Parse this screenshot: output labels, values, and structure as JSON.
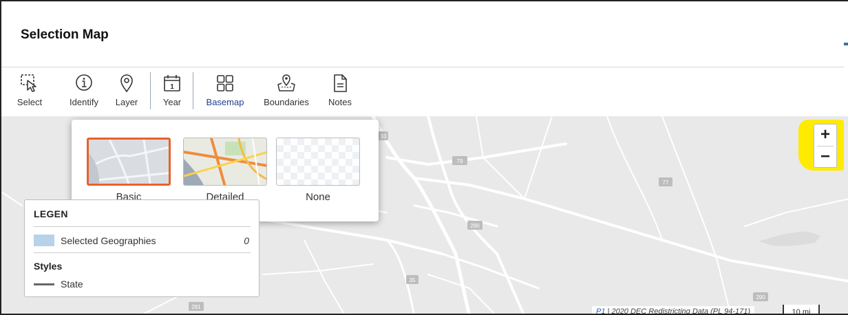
{
  "window": {
    "title": "Selection Map"
  },
  "toolbar": {
    "tools": [
      {
        "id": "select",
        "label": "Select",
        "icon": "select-icon"
      },
      {
        "id": "identify",
        "label": "Identify",
        "icon": "info-icon"
      },
      {
        "id": "layer",
        "label": "Layer",
        "icon": "location-pin-icon"
      },
      {
        "id": "year",
        "label": "Year",
        "icon": "calendar-icon",
        "badge": "1"
      },
      {
        "id": "basemap",
        "label": "Basemap",
        "icon": "grid-icon",
        "active": true
      },
      {
        "id": "boundaries",
        "label": "Boundaries",
        "icon": "map-pin-area-icon"
      },
      {
        "id": "notes",
        "label": "Notes",
        "icon": "document-icon"
      }
    ]
  },
  "basemap_popup": {
    "options": [
      {
        "label": "Basic",
        "selected": true
      },
      {
        "label": "Detailed",
        "selected": false
      },
      {
        "label": "None",
        "selected": false
      }
    ]
  },
  "legend": {
    "heading": "LEGEN",
    "selected_label": "Selected Geographies",
    "selected_count": "0",
    "styles_heading": "Styles",
    "style_item": "State"
  },
  "map": {
    "road_shields": [
      "79",
      "77",
      "290",
      "35",
      "281",
      "290",
      "33"
    ],
    "attribution_link": "P1",
    "attribution_text": "2020 DEC Redistricting Data (PL 94-171)",
    "scale": "10 mi"
  },
  "zoom": {
    "in_label": "+",
    "out_label": "−"
  },
  "colors": {
    "highlight": "#ffeb00",
    "selected_border": "#e8612c",
    "selected_swatch": "#b8d2ea",
    "map_bg": "#e9e9e9"
  }
}
